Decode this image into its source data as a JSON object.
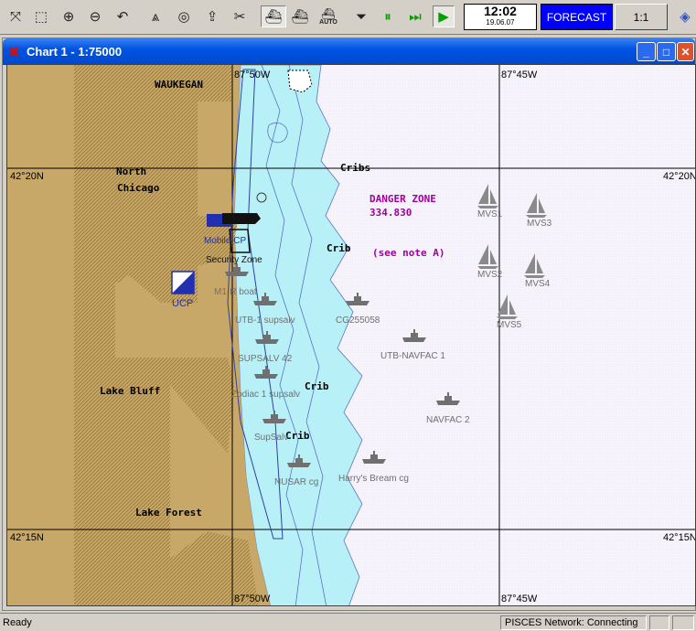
{
  "toolbar": {
    "buttons": [
      {
        "icon": "pan-icon",
        "glyph": "⤧"
      },
      {
        "icon": "zoom-box-icon",
        "glyph": "⬚"
      },
      {
        "icon": "zoom-in-icon",
        "glyph": "⊕"
      },
      {
        "icon": "zoom-out-icon",
        "glyph": "⊖"
      },
      {
        "icon": "undo-icon",
        "glyph": "↶"
      },
      {
        "icon": "compass-icon",
        "glyph": "⩓"
      },
      {
        "icon": "target-icon",
        "glyph": "◎"
      },
      {
        "icon": "upload-icon",
        "glyph": "⇪"
      },
      {
        "icon": "layers-icon",
        "glyph": "✂"
      },
      {
        "icon": "vessel-1-icon",
        "glyph": "⛴"
      },
      {
        "icon": "vessel-2-icon",
        "glyph": "⛴"
      },
      {
        "icon": "auto-vessel-icon",
        "glyph": "⛴",
        "label": "AUTO"
      },
      {
        "icon": "stop-icon",
        "glyph": "⏷"
      },
      {
        "icon": "pause-icon",
        "glyph": "⏸"
      },
      {
        "icon": "fast-forward-icon",
        "glyph": "⏭"
      },
      {
        "icon": "play-icon",
        "glyph": "▶"
      }
    ],
    "time": "12:02",
    "date": "19.06.07",
    "forecast_label": "FORECAST",
    "scale_label": "1:1"
  },
  "window": {
    "title": "Chart 1 - 1:75000"
  },
  "chart": {
    "grid_labels": {
      "lon_left": "87°50W",
      "lon_right": "87°45W",
      "lat_top": "42°20N",
      "lat_bottom": "42°15N"
    },
    "places": [
      "WAUKEGAN",
      "North",
      "Chicago",
      "Lake Bluff",
      "Lake Forest"
    ],
    "cribs": [
      "Cribs",
      "Crib",
      "Crib",
      "Crib",
      "Crib"
    ],
    "danger_zone": [
      "DANGER ZONE",
      "334.830",
      "(see note A)"
    ],
    "vessels": [
      "MVS1",
      "MVS3",
      "MVS2",
      "MVS4",
      "MVS5",
      "CG255058",
      "UTB-NAVFAC 1",
      "NAVFAC 2",
      "Harry's Bream cg",
      "UTB-1 supsalv",
      "SUPSALV 42",
      "Zodiac 1 supsalv",
      "SupSalv",
      "NUSAR cg",
      "M1-R boat"
    ],
    "markers": [
      "Mobile CP",
      "Security Zone",
      "UCP"
    ]
  },
  "status": {
    "left": "Ready",
    "network": "PISCES Network: Connecting"
  },
  "colors": {
    "land": "#c8a868",
    "shallow_water": "#b8f0f8",
    "deep_water": "#f7f5fb",
    "danger": "#a000a0"
  }
}
